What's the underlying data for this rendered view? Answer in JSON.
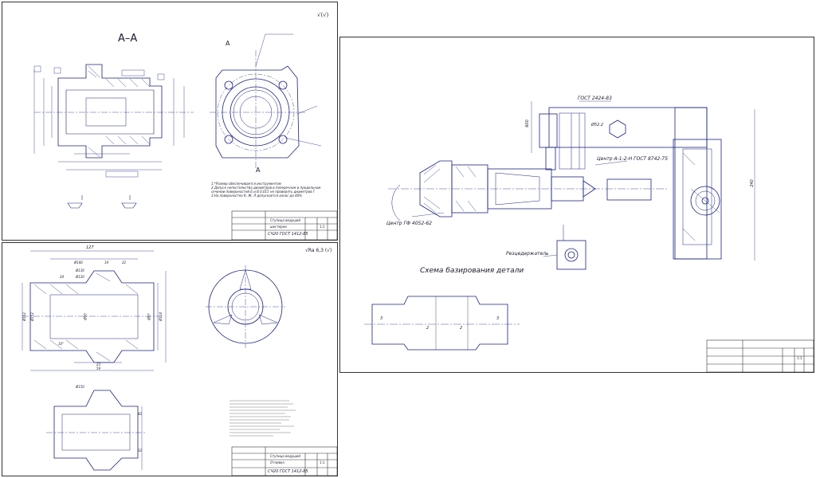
{
  "sheet1": {
    "section_title": "А–А",
    "roughness": "√(√)",
    "section_mark": "А",
    "notes": [
      "1.*Размер обеспечивается инструментом",
      "2.Допуск непостоянства диаметров в поперечном и продольном",
      "сечении поверхностей Б и В 0,015 не проверять диаметров Г",
      "3.На поверхностях К, Ж, Л допускается износ до 40%"
    ],
    "title_block": {
      "name_line1": "Ступица ведущей",
      "name_line2": "шестерни",
      "material": "СЧ20 ГОСТ 1412-85",
      "scale": "1:1"
    }
  },
  "sheet2": {
    "roughness": "√Ra 6,3 (√)",
    "dims": [
      "127",
      "Ø180",
      "Ø136",
      "Ø120",
      "14",
      "22",
      "24",
      "Ø102",
      "Ø152",
      "Ø60",
      "Ø97",
      "Ø114",
      "10°",
      "23",
      "59",
      "Ø150",
      "42",
      "32"
    ],
    "title_block": {
      "name_line1": "Ступица ведущей",
      "name_line2": "Отливка",
      "material": "СЧ20 ГОСТ 1412-85",
      "scale": "1:1"
    }
  },
  "sheet3": {
    "callouts": {
      "gost_bolt": "ГОСТ 2424-83",
      "center": "Центр А-1-2-Н ГОСТ 8742-75",
      "center2": "Центр ГФ 4052-62",
      "cutter": "Резцедержатель",
      "pitch": "Ø52.2",
      "dim_600": "600",
      "dim_240": "240"
    },
    "scheme_title": "Схема базирования детали",
    "scheme_numbers": [
      "3",
      "2",
      "2",
      "3"
    ],
    "title_block": {
      "scale": "1:1"
    }
  },
  "colors": {
    "line": "#1a237e",
    "border": "#333333",
    "thin": "#3949ab"
  }
}
